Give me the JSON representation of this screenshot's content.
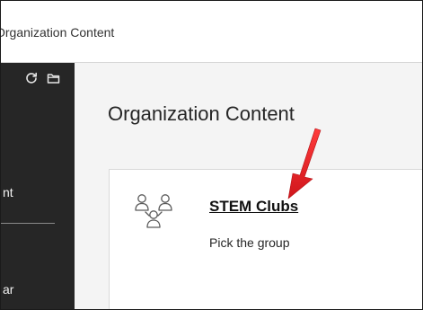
{
  "topbar": {
    "title": "Organization Content"
  },
  "sidebar": {
    "icons": [
      "refresh-icon",
      "folder-icon"
    ],
    "items": [
      {
        "label": "nt"
      },
      {
        "label": "ar"
      }
    ]
  },
  "main": {
    "title": "Organization Content",
    "group": {
      "name": "STEM Clubs",
      "description": "Pick the group",
      "icon": "group-icon"
    }
  },
  "annotation": {
    "arrow_color": "#e8232a"
  }
}
